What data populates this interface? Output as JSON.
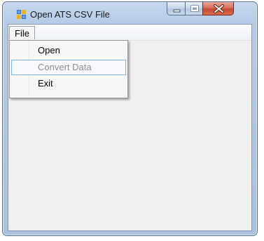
{
  "window": {
    "title": "Open ATS CSV File",
    "controls": {
      "minimize": "minimize-icon",
      "maximize": "maximize-icon",
      "close": "close-icon"
    }
  },
  "menubar": {
    "file_label": "File"
  },
  "file_menu": {
    "items": [
      {
        "label": "Open",
        "enabled": true
      },
      {
        "label": "Convert Data",
        "enabled": false,
        "highlighted": true
      },
      {
        "label": "Exit",
        "enabled": true
      }
    ]
  },
  "colors": {
    "close_button": "#c44a30",
    "highlight_border": "#7eb4ea",
    "disabled_text": "#8d8d8d"
  }
}
